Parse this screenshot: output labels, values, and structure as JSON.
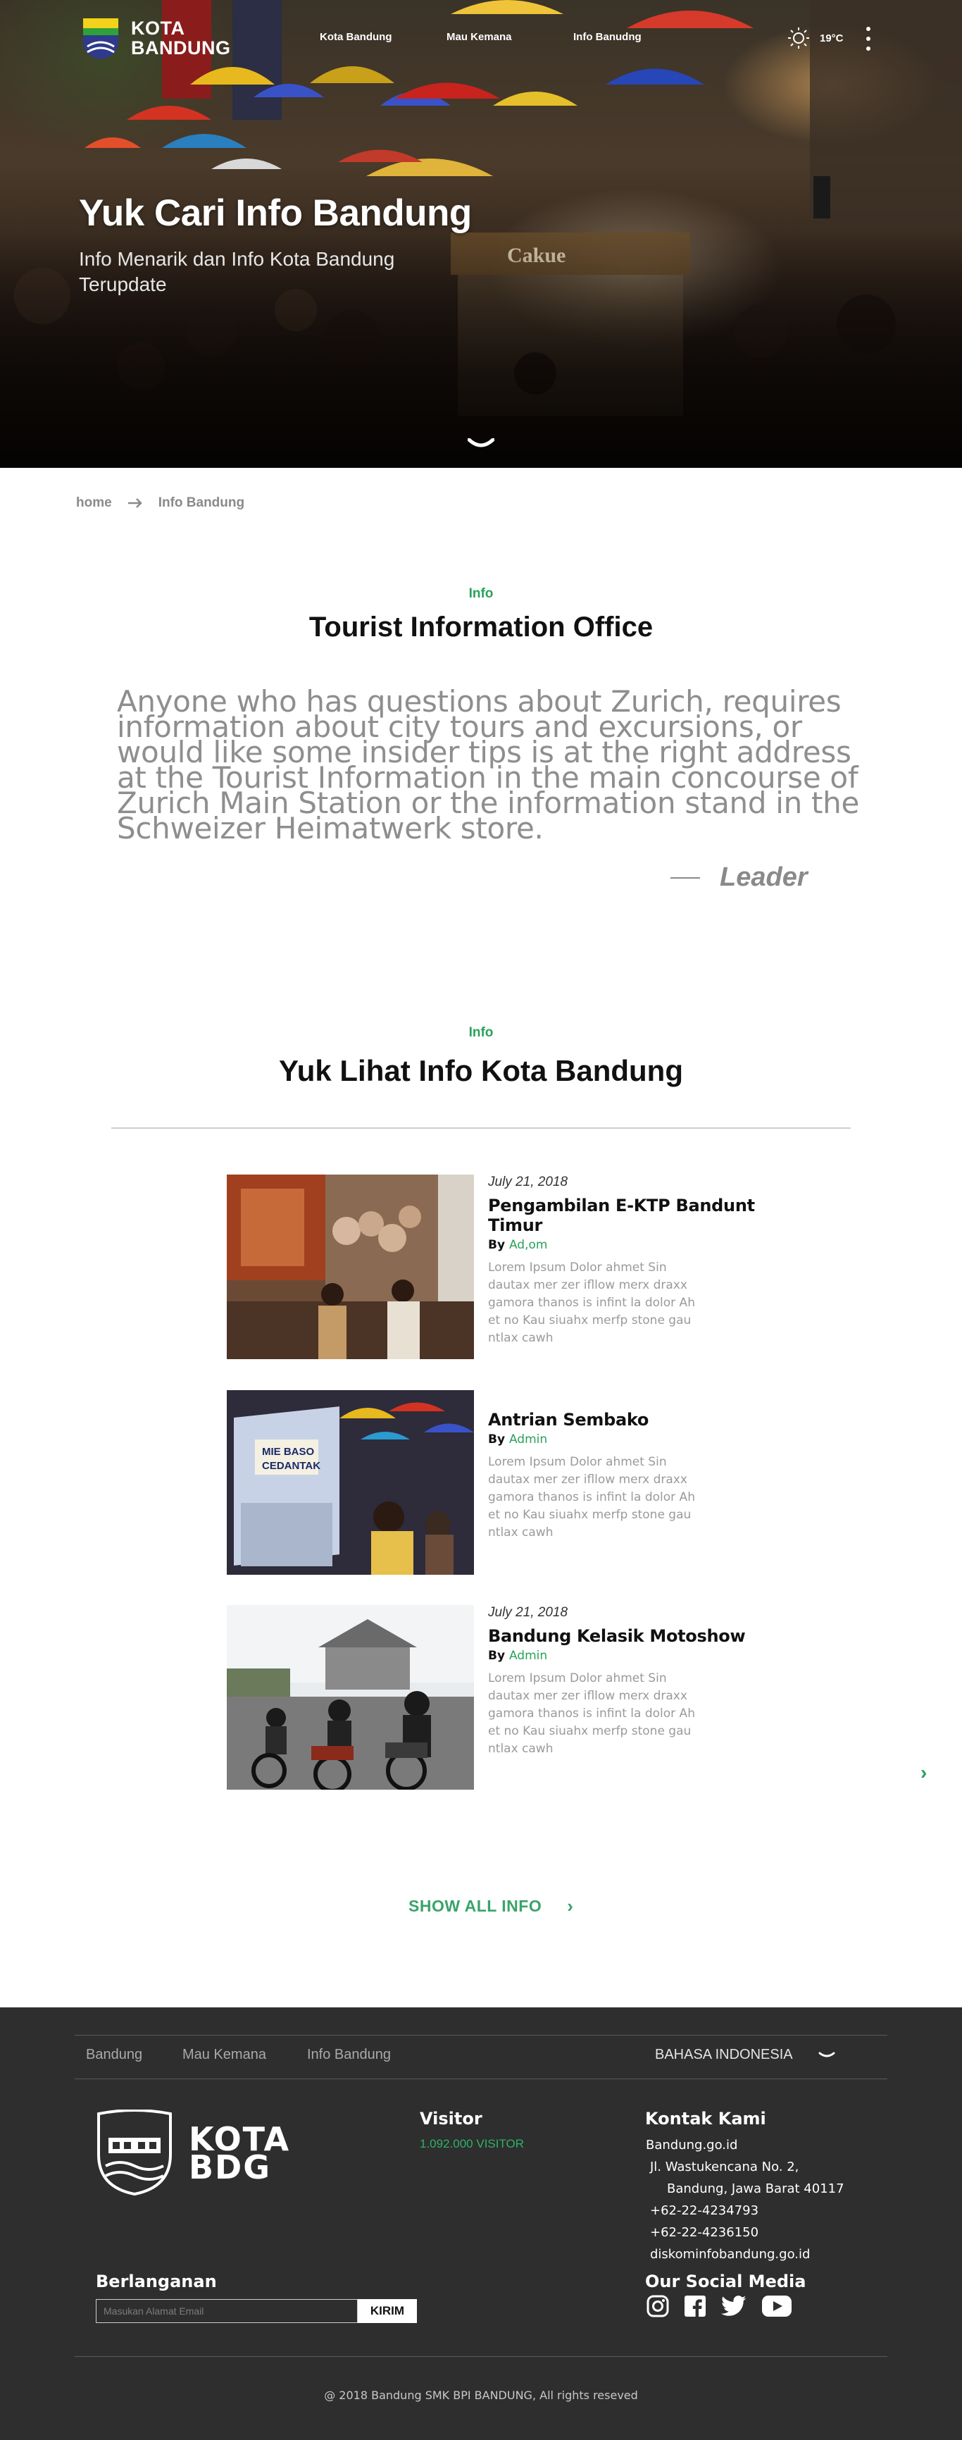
{
  "nav": {
    "logo_line1": "KOTA",
    "logo_line2": "BANDUNG",
    "links": [
      "Kota Bandung",
      "Mau Kemana",
      "Info Banudng"
    ],
    "weather_temp": "19°C"
  },
  "hero": {
    "title": "Yuk Cari Info Bandung",
    "subtitle": "Info Menarik dan Info Kota Bandung Terupdate"
  },
  "breadcrumb": {
    "home": "home",
    "current": "Info Bandung"
  },
  "quote_section": {
    "eyebrow": "Info",
    "title": "Tourist Information Office",
    "quote": "Anyone who has questions about Zurich, requires information about city tours and excursions, or would like some insider tips is at the right address at the Tourist Information in the main concourse of Zurich Main Station or the information stand in the Schweizer Heimatwerk store.",
    "author": "Leader"
  },
  "articles_section": {
    "eyebrow": "Info",
    "title": "Yuk Lihat Info Kota Bandung",
    "by_label": "By",
    "items": [
      {
        "date": "July 21, 2018",
        "title": "Pengambilan E-KTP Bandunt Timur",
        "author": "Ad,om",
        "excerpt": "Lorem Ipsum Dolor ahmet Sin dautax mer zer ifllow merx draxx gamora thanos is infint la dolor Ah et no Kau siuahx merfp stone gau ntlax cawh"
      },
      {
        "date": "",
        "title": "Antrian Sembako",
        "author": "Admin",
        "excerpt": "Lorem Ipsum Dolor ahmet Sin dautax mer zer ifllow merx draxx gamora thanos is infint la dolor Ah et no Kau siuahx merfp stone gau ntlax cawh"
      },
      {
        "date": "July 21, 2018",
        "title": "Bandung Kelasik Motoshow",
        "author": "Admin",
        "excerpt": "Lorem Ipsum Dolor ahmet Sin dautax mer zer ifllow merx draxx gamora thanos is infint la dolor Ah et no Kau siuahx merfp stone gau ntlax cawh"
      }
    ],
    "show_all": "SHOW ALL INFO"
  },
  "footer": {
    "nav": [
      "Bandung",
      "Mau Kemana",
      "Info Bandung"
    ],
    "language": "BAHASA INDONESIA",
    "logo_line1": "KOTA",
    "logo_line2": "BDG",
    "visitor_heading": "Visitor",
    "visitor_count": "1.092.000 VISITOR",
    "contact_heading": "Kontak Kami",
    "contact": {
      "site": "Bandung.go.id",
      "address1": "Jl. Wastukencana No. 2,",
      "address2": "Bandung, Jawa Barat 40117",
      "phone1": "+62-22-4234793",
      "phone2": "+62-22-4236150",
      "email": "diskominfobandung.go.id"
    },
    "subscribe_heading": "Berlanganan",
    "subscribe_placeholder": "Masukan Alamat Email",
    "subscribe_button": "KIRIM",
    "social_heading": "Our Social Media",
    "social": [
      "instagram-icon",
      "facebook-icon",
      "twitter-icon",
      "youtube-icon"
    ],
    "copyright": "@ 2018 Bandung SMK BPI BANDUNG, All rights reseved"
  },
  "colors": {
    "accent": "#2aa15a",
    "footer_bg": "#2e2e2e",
    "quote_gray": "#8e8e8e"
  }
}
